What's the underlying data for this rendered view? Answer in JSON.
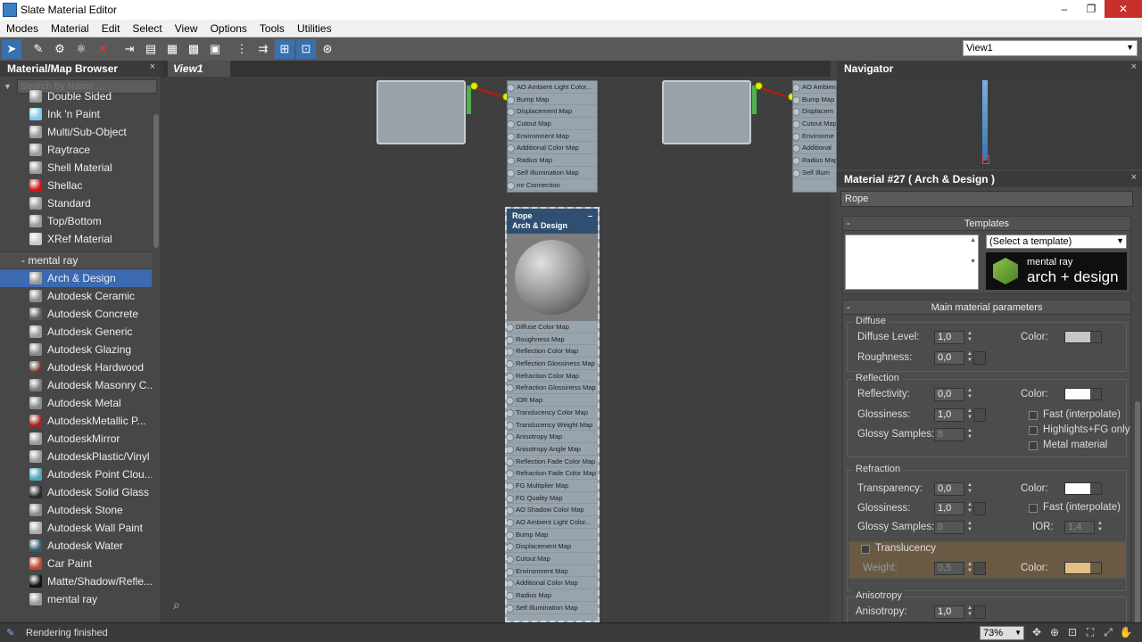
{
  "window": {
    "title": "Slate Material Editor",
    "minimize": "–",
    "maximize": "❐",
    "close": "✕"
  },
  "menu": [
    "Modes",
    "Material",
    "Edit",
    "Select",
    "View",
    "Options",
    "Tools",
    "Utilities"
  ],
  "toolbar": {
    "view_select": "View1"
  },
  "browser": {
    "title": "Material/Map Browser",
    "close": "×",
    "search_placeholder": "Search by Name ...",
    "items_top": [
      {
        "label": "Double Sided",
        "swatch": "#9a9a9a"
      },
      {
        "label": "Ink 'n Paint",
        "swatch": "#7ec8e8"
      },
      {
        "label": "Multi/Sub-Object",
        "swatch": "#9a9a9a"
      },
      {
        "label": "Raytrace",
        "swatch": "#9a9a9a"
      },
      {
        "label": "Shell Material",
        "swatch": "#9a9a9a"
      },
      {
        "label": "Shellac",
        "swatch": "#d41414"
      },
      {
        "label": "Standard",
        "swatch": "#9a9a9a"
      },
      {
        "label": "Top/Bottom",
        "swatch": "#9a9a9a"
      },
      {
        "label": "XRef Material",
        "swatch": "#c8c8c8"
      }
    ],
    "group_label": "- mental ray",
    "items_mr": [
      {
        "label": "Arch & Design",
        "swatch": "#9a9a9a",
        "selected": true
      },
      {
        "label": "Autodesk Ceramic",
        "swatch": "#8c8c8c"
      },
      {
        "label": "Autodesk Concrete",
        "swatch": "#5e5e5e"
      },
      {
        "label": "Autodesk Generic",
        "swatch": "#9a9a9a"
      },
      {
        "label": "Autodesk Glazing",
        "swatch": "#8a8a8a"
      },
      {
        "label": "Autodesk Hardwood",
        "swatch": "#6b3a2a"
      },
      {
        "label": "Autodesk Masonry C...",
        "swatch": "#7a7a7a"
      },
      {
        "label": "Autodesk Metal",
        "swatch": "#8a8a8a"
      },
      {
        "label": "AutodeskMetallic P...",
        "swatch": "#a02424"
      },
      {
        "label": "AutodeskMirror",
        "swatch": "#9a9a9a"
      },
      {
        "label": "AutodeskPlastic/Vinyl",
        "swatch": "#9a9a9a"
      },
      {
        "label": "Autodesk Point Clou...",
        "swatch": "#4aa6b8"
      },
      {
        "label": "Autodesk Solid Glass",
        "swatch": "#2a2a2a"
      },
      {
        "label": "Autodesk Stone",
        "swatch": "#8a8a8a"
      },
      {
        "label": "Autodesk Wall Paint",
        "swatch": "#aaaaaa"
      },
      {
        "label": "Autodesk Water",
        "swatch": "#2e5e6e"
      },
      {
        "label": "Car Paint",
        "swatch": "#c2462e"
      },
      {
        "label": "Matte/Shadow/Refle...",
        "swatch": "#111111"
      },
      {
        "label": "mental ray",
        "swatch": "#9a9a9a"
      }
    ]
  },
  "view": {
    "tab": "View1",
    "top_node_slots": [
      "AO Ambient Light Color...",
      "Bump Map",
      "Displacement Map",
      "Cutout Map",
      "Environment Map",
      "Additional Color Map",
      "Radius Map",
      "Self Illumination Map",
      "mr Connection"
    ],
    "right_node_slots": [
      "AO Ambient",
      "Bump Map",
      "Displacem",
      "Cutout Map",
      "Environme",
      "Additional",
      "Radius Map",
      "Self Illum"
    ],
    "rope_node": {
      "title": "Rope",
      "subtitle": "Arch & Design",
      "slots": [
        "Diffuse Color Map",
        "Roughness Map",
        "Reflection Color Map",
        "Reflection Glossiness Map",
        "Refraction Color Map",
        "Refraction Glossiness Map",
        "IOR Map",
        "Translucency Color Map",
        "Translucency Weight Map",
        "Anisotropy Map",
        "Anisotropy Angle Map",
        "Reflection Fade Color Map",
        "Refraction Fade Color Map",
        "FG Multiplier Map",
        "FG Quality Map",
        "AO Shadow Color Map",
        "AO Ambient Light Color...",
        "Bump Map",
        "Displacement Map",
        "Cutout Map",
        "Environment Map",
        "Additional Color Map",
        "Radius Map",
        "Self Illumination Map"
      ]
    }
  },
  "navigator": {
    "title": "Navigator",
    "close": "×"
  },
  "props": {
    "title": "Material #27  ( Arch & Design )",
    "close": "×",
    "name": "Rope",
    "templates": {
      "title": "Templates",
      "select": "(Select a template)",
      "logo_line1": "mental ray",
      "logo_line2": "arch + design"
    },
    "main": {
      "title": "Main material parameters",
      "diffuse": {
        "label": "Diffuse",
        "level_label": "Diffuse Level:",
        "level": "1,0",
        "rough_label": "Roughness:",
        "rough": "0,0",
        "color_label": "Color:",
        "color": "#c7c7c7"
      },
      "reflection": {
        "label": "Reflection",
        "refl_label": "Reflectivity:",
        "refl": "0,0",
        "gloss_label": "Glossiness:",
        "gloss": "1,0",
        "samples_label": "Glossy Samples:",
        "samples": "8",
        "color_label": "Color:",
        "color": "#ffffff",
        "fast": "Fast (interpolate)",
        "highlights": "Highlights+FG only",
        "metal": "Metal material"
      },
      "refraction": {
        "label": "Refraction",
        "trans_label": "Transparency:",
        "trans": "0,0",
        "gloss_label": "Glossiness:",
        "gloss": "1,0",
        "samples_label": "Glossy Samples:",
        "samples": "8",
        "color_label": "Color:",
        "color": "#ffffff",
        "fast": "Fast (interpolate)",
        "ior_label": "IOR:",
        "ior": "1,4",
        "translucency": "Translucency",
        "weight_label": "Weight:",
        "weight": "0,5",
        "t_color_label": "Color:",
        "t_color": "#e2bf85"
      },
      "anisotropy": {
        "label": "Anisotropy",
        "aniso_label": "Anisotropy:",
        "aniso": "1,0"
      }
    }
  },
  "status": {
    "text": "Rendering finished",
    "zoom": "73%"
  }
}
